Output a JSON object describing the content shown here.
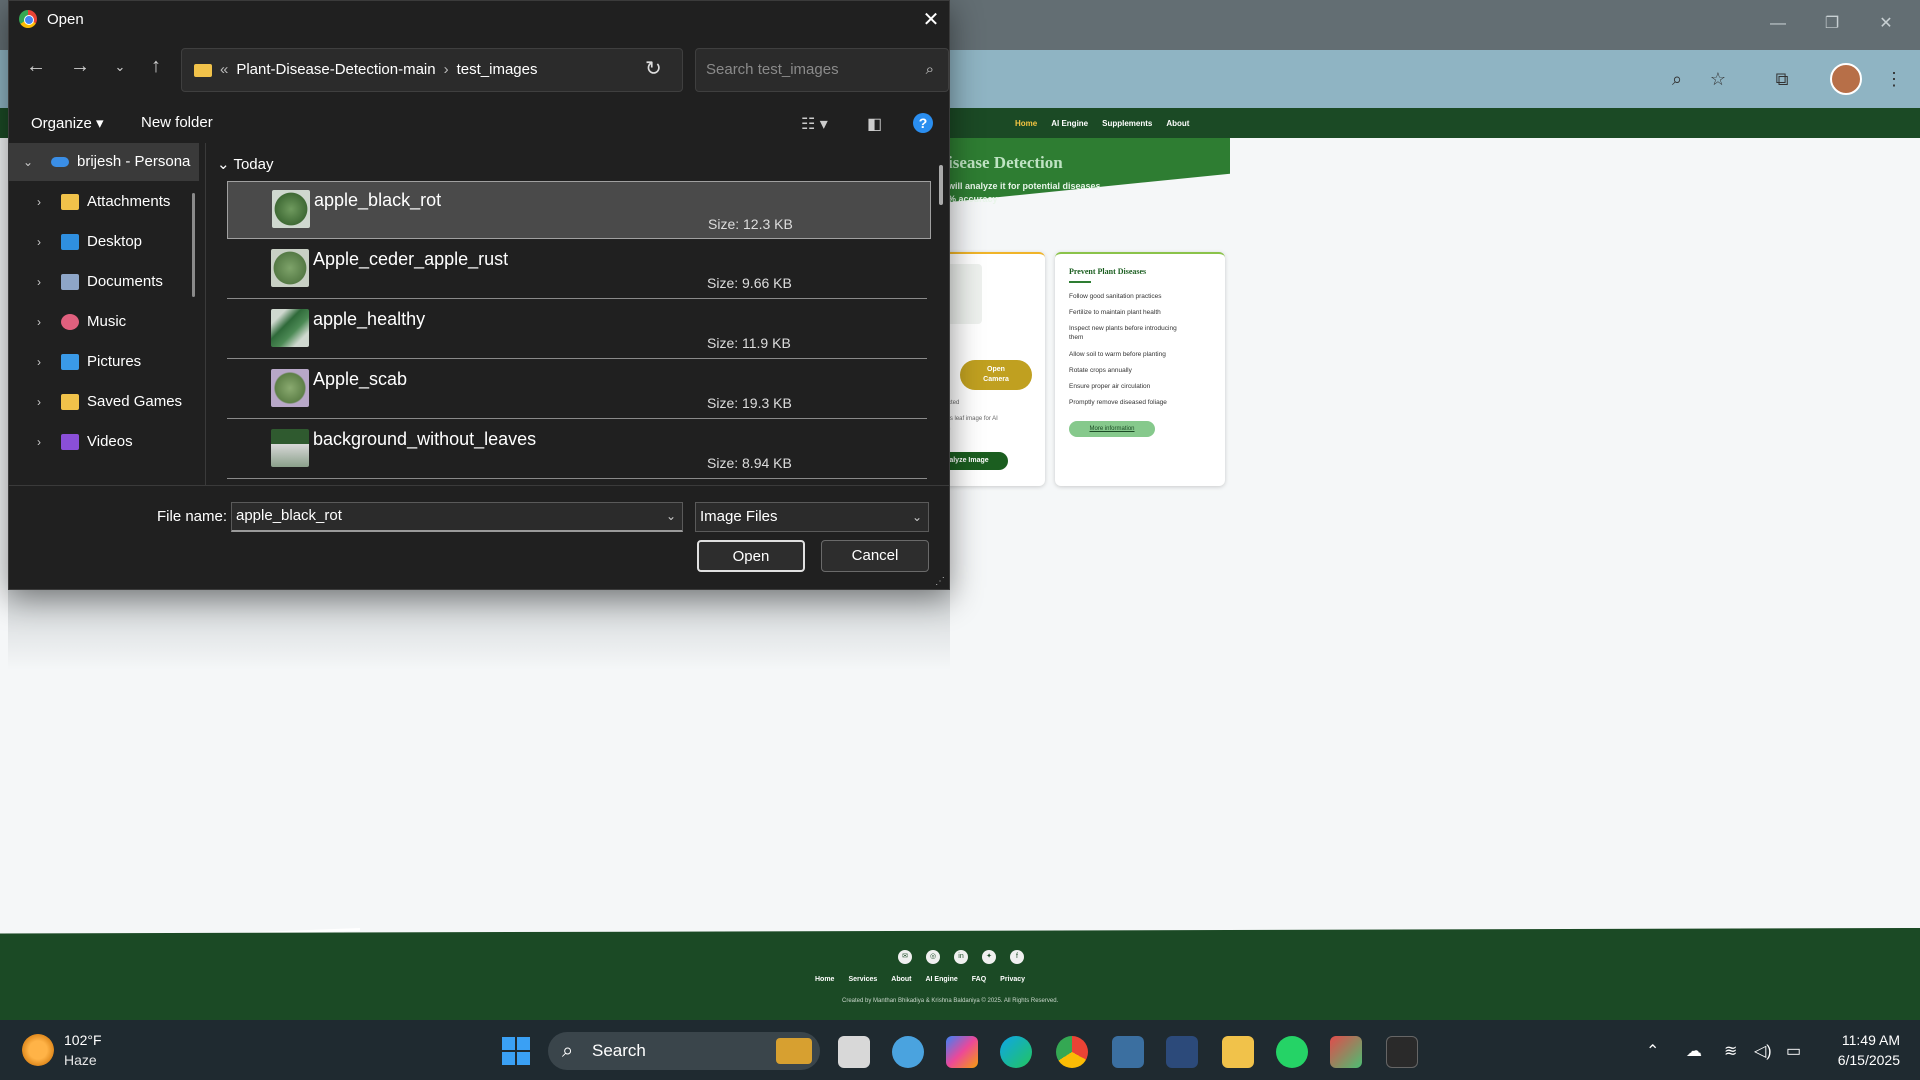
{
  "dialog": {
    "title": "Open",
    "breadcrumb": [
      "Plant-Disease-Detection-main",
      "test_images"
    ],
    "search_placeholder": "Search test_images",
    "organize_label": "Organize",
    "new_folder_label": "New folder",
    "group_header": "Today",
    "nav_pane": [
      {
        "label": "brijesh - Persona",
        "expanded": true,
        "icon": "onedrive-cloud-icon"
      },
      {
        "label": "Attachments",
        "icon": "folder-icon"
      },
      {
        "label": "Desktop",
        "icon": "desktop-icon"
      },
      {
        "label": "Documents",
        "icon": "documents-icon"
      },
      {
        "label": "Music",
        "icon": "music-icon"
      },
      {
        "label": "Pictures",
        "icon": "pictures-icon"
      },
      {
        "label": "Saved Games",
        "icon": "folder-icon"
      },
      {
        "label": "Videos",
        "icon": "videos-icon"
      }
    ],
    "files": [
      {
        "name": "apple_black_rot",
        "size": "Size: 12.3 KB",
        "selected": true
      },
      {
        "name": "Apple_ceder_apple_rust",
        "size": "Size: 9.66 KB"
      },
      {
        "name": "apple_healthy",
        "size": "Size: 11.9 KB"
      },
      {
        "name": "Apple_scab",
        "size": "Size: 19.3 KB"
      },
      {
        "name": "background_without_leaves",
        "size": "Size: 8.94 KB"
      }
    ],
    "file_name_label": "File name:",
    "file_name_value": "apple_black_rot",
    "file_type": "Image Files",
    "open_label": "Open",
    "cancel_label": "Cancel"
  },
  "site": {
    "nav": [
      "Home",
      "AI Engine",
      "Supplements",
      "About"
    ],
    "hero_title": "isease Detection",
    "hero_sub_1": "will analyze it for potential diseases",
    "hero_sub_2": "% accuracy",
    "upload_card": {
      "camera_label_1": "Open",
      "camera_label_2": "Camera",
      "selected_text": "e selected",
      "hint_1": "r plant's leaf image for AI",
      "hint_2": "nalysis",
      "analyze_label": "alyze Image"
    },
    "prevent_card": {
      "title": "Prevent Plant Diseases",
      "tips": [
        "Follow good sanitation practices",
        "Fertilize to maintain plant health",
        "Inspect new plants before introducing them",
        "Allow soil to warm before planting",
        "Rotate crops annually",
        "Ensure proper air circulation",
        "Promptly remove diseased foliage"
      ],
      "more_label": "More information"
    },
    "footer_links": [
      "Home",
      "Services",
      "About",
      "AI Engine",
      "FAQ",
      "Privacy"
    ],
    "footer_copy": "Created by Manthan Bhikadiya & Krishna Baldaniya © 2025. All Rights Reserved."
  },
  "taskbar": {
    "weather_temp": "102°F",
    "weather_desc": "Haze",
    "search_label": "Search",
    "time": "11:49 AM",
    "date": "6/15/2025"
  },
  "colors": {
    "site_green": "#1b4a25",
    "accent_green": "#2e7d32",
    "dialog_bg": "#202020",
    "selection": "#4a4a4a"
  }
}
